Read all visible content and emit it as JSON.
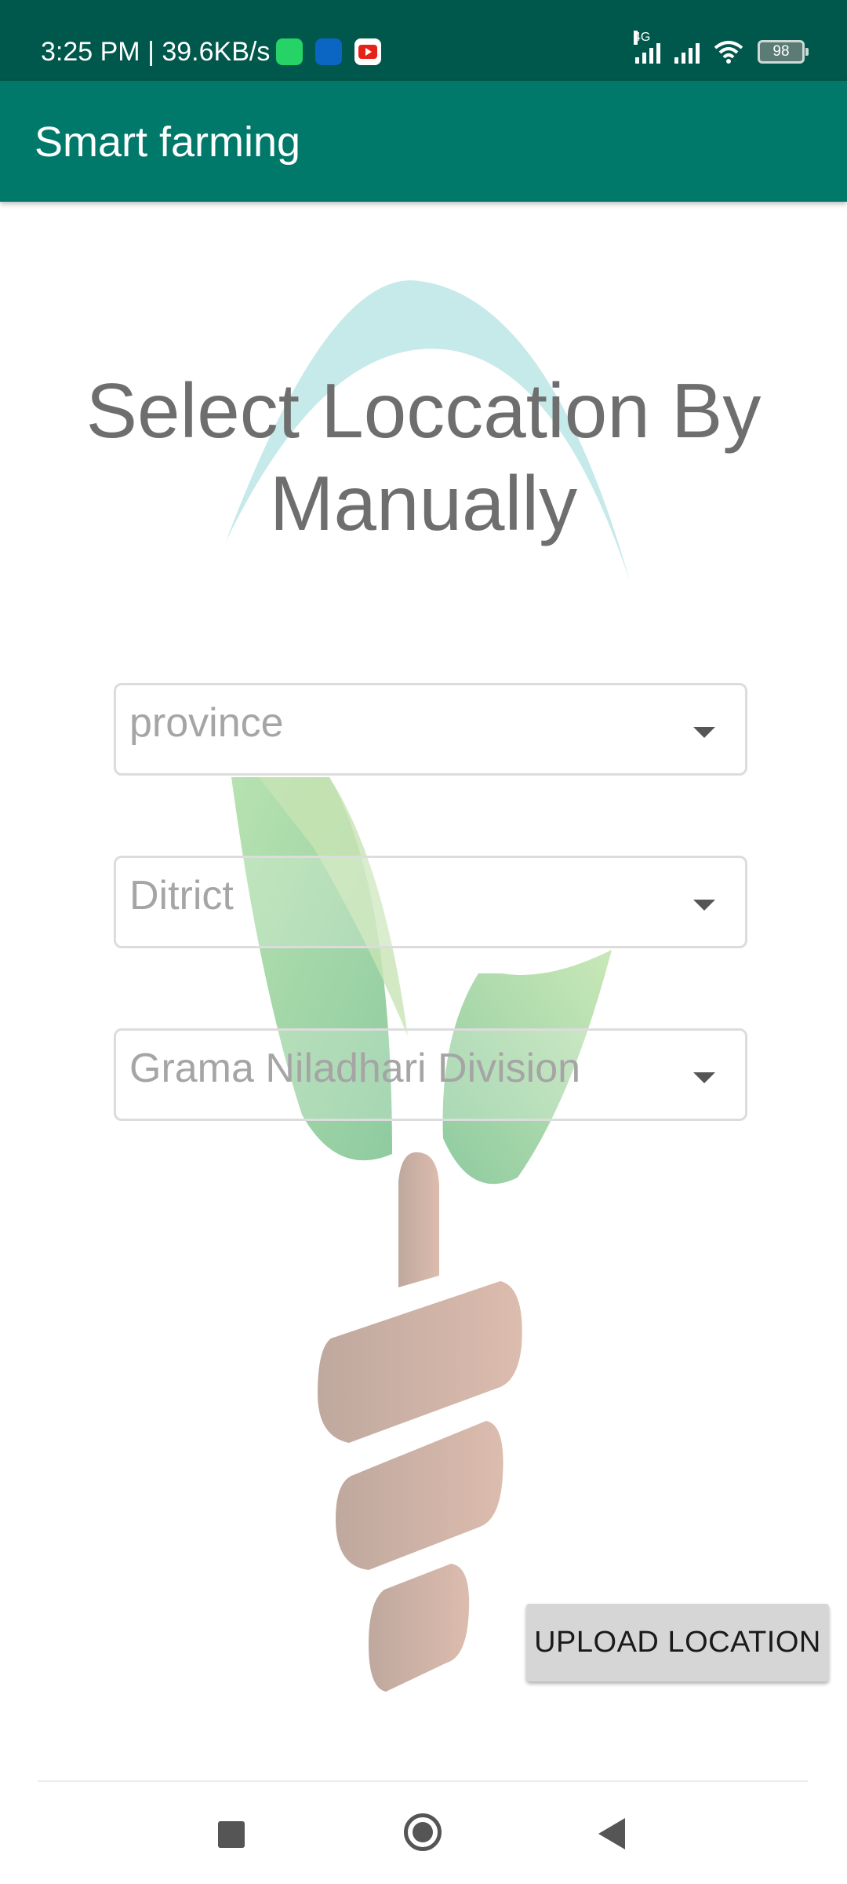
{
  "status_bar": {
    "time_speed": "3:25 PM | 39.6KB/s",
    "network_label": "4G",
    "battery_level": "98",
    "notification_icons": [
      "whatsapp-icon",
      "linkedin-icon",
      "youtube-icon"
    ]
  },
  "app_bar": {
    "title": "Smart farming"
  },
  "main": {
    "heading": "Select Loccation By Manually",
    "dropdowns": [
      {
        "placeholder": "province"
      },
      {
        "placeholder": "Ditrict"
      },
      {
        "placeholder": "Grama Niladhari Division"
      }
    ],
    "upload_button_label": "UPLOAD LOCATION"
  },
  "nav_bar": {
    "icons": [
      "recent-apps-icon",
      "home-icon",
      "back-icon"
    ]
  },
  "colors": {
    "status_bar": "#00574b",
    "app_bar": "#00796b",
    "heading_text": "#6e6e6e",
    "placeholder_text": "#a5a5a5",
    "button_bg": "#d6d6d6",
    "logo_arc": "#c6e9e9",
    "logo_leaf": "#a8dba9",
    "logo_hand": "#d3b3a4"
  }
}
